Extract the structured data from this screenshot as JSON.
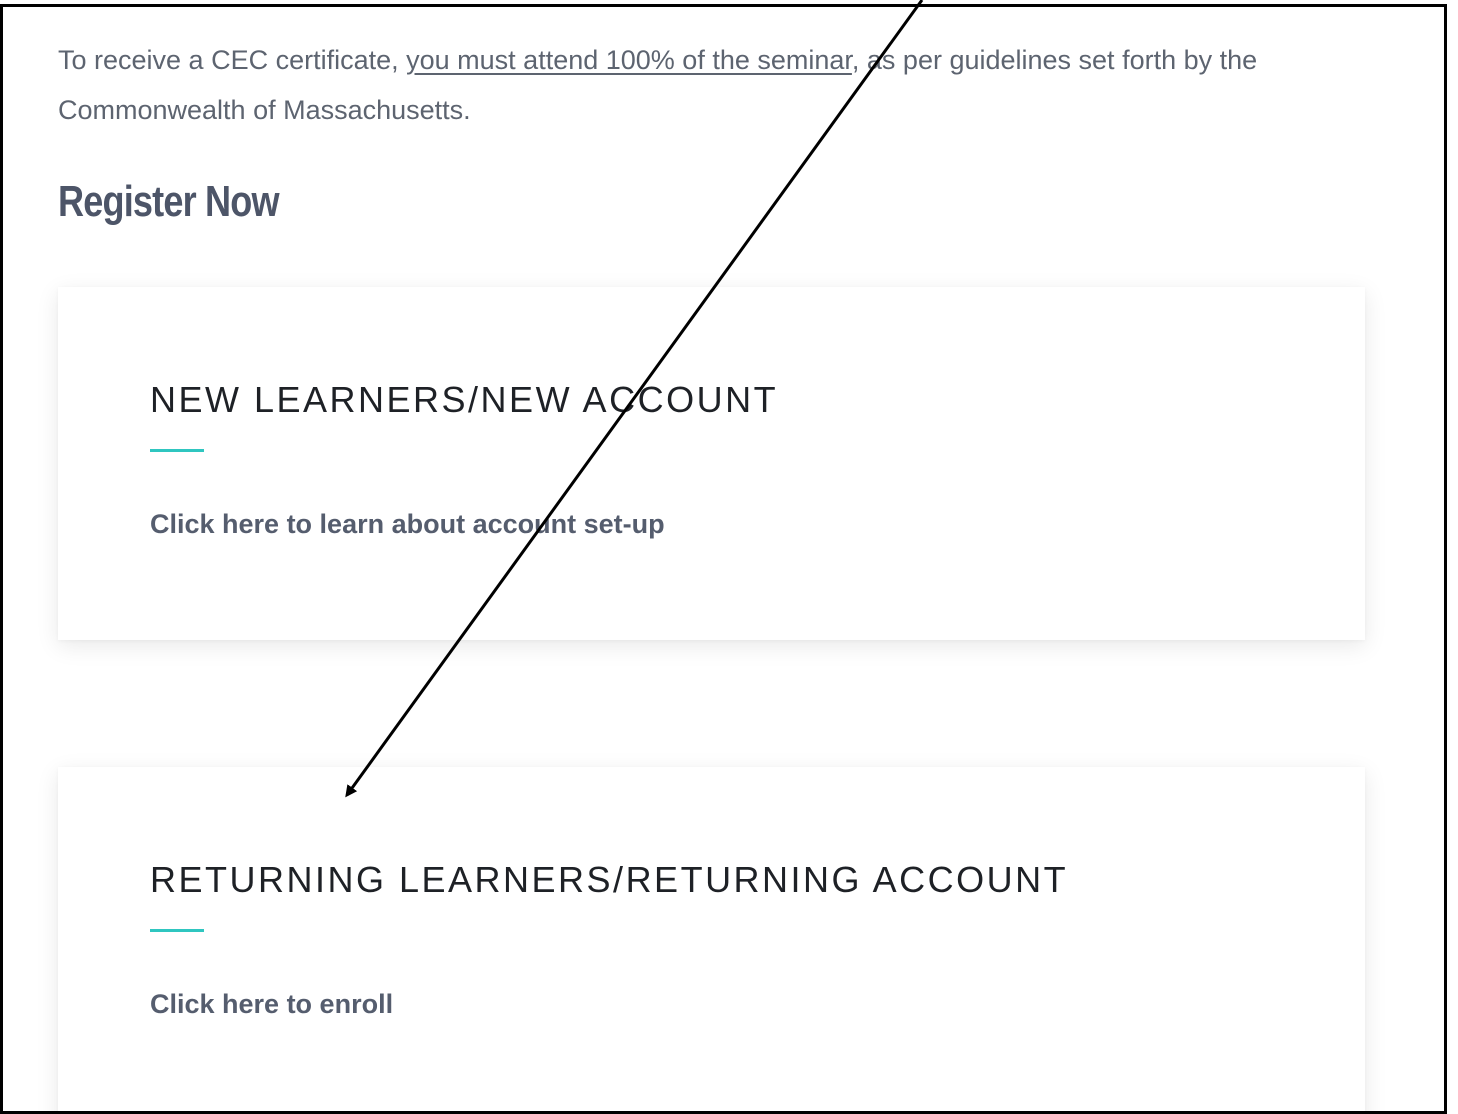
{
  "intro": {
    "prefix": "To receive a CEC certificate, ",
    "link_text": "you must attend 100% of the seminar",
    "suffix": ", as per guidelines set forth by the Commonwealth of Massachusetts."
  },
  "heading": "Register Now",
  "cards": [
    {
      "title": "NEW LEARNERS/NEW ACCOUNT",
      "link": "Click here to learn about account set-up"
    },
    {
      "title": "RETURNING LEARNERS/RETURNING ACCOUNT",
      "link": "Click here to enroll"
    }
  ],
  "colors": {
    "accent": "#2fc6c0",
    "text": "#5d6470",
    "heading": "#4d5568",
    "card_title": "#1e2126",
    "arrow": "#000000"
  },
  "icons": {
    "annotation": "arrow-icon"
  }
}
